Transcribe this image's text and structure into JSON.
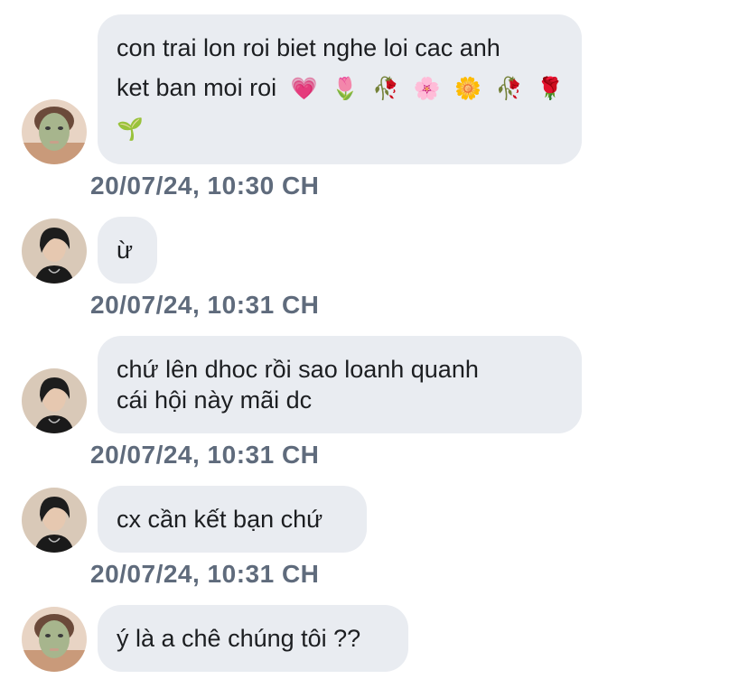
{
  "messages": [
    {
      "sender": "mask-avatar",
      "lines": [
        "con trai lon roi biet nghe loi cac anh",
        "ket ban moi roi"
      ],
      "emoji_line2": [
        "💗",
        "🌷",
        "🥀",
        "🌸",
        "🌼",
        "🥀",
        "🌹"
      ],
      "emoji_line3": [
        "🌱"
      ],
      "timestamp": "20/07/24, 10:30 CH"
    },
    {
      "sender": "dark-hair-avatar",
      "lines": [
        "ừ"
      ],
      "timestamp": "20/07/24, 10:31 CH"
    },
    {
      "sender": "dark-hair-avatar",
      "lines": [
        "chứ lên dhoc rồi sao loanh quanh",
        "cái hội này mãi dc"
      ],
      "timestamp": "20/07/24, 10:31 CH"
    },
    {
      "sender": "dark-hair-avatar",
      "lines": [
        "cx cần kết bạn chứ"
      ],
      "timestamp": "20/07/24, 10:31 CH"
    },
    {
      "sender": "mask-avatar",
      "lines": [
        "ý là a chê chúng tôi ??"
      ]
    }
  ],
  "colors": {
    "bubble": "#e9ecf1",
    "timestamp": "#5f6b7c",
    "text": "#1c1e21"
  }
}
